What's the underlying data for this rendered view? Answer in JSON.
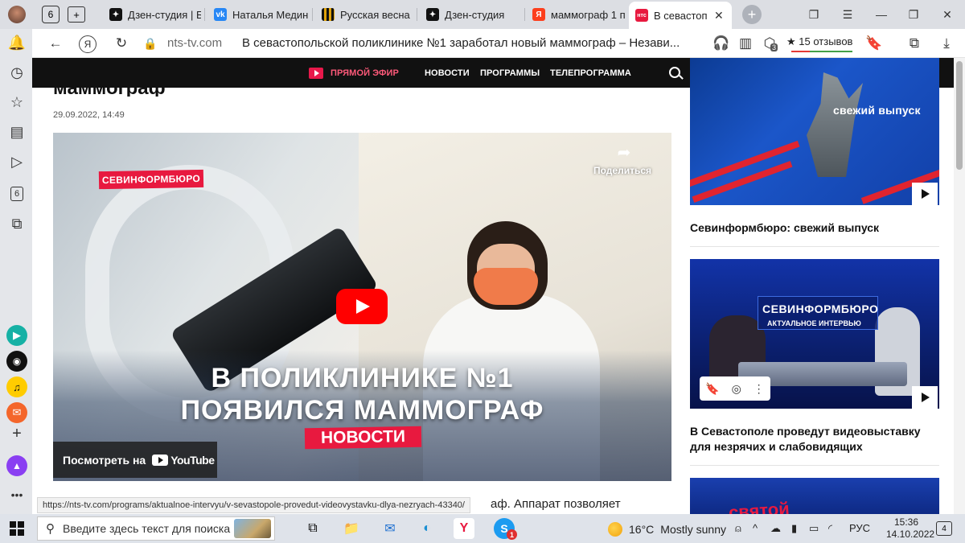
{
  "browser": {
    "tab_counter": "6",
    "tabs": [
      {
        "label": "Дзен-студия | Б",
        "favicon": "dzen-icon",
        "color": "#111111"
      },
      {
        "label": "Наталья Медин",
        "favicon": "vk-icon",
        "color": "#2787f5"
      },
      {
        "label": "Русская весна",
        "favicon": "russian-spring-icon",
        "color": "#e0a20a"
      },
      {
        "label": "Дзен-студия",
        "favicon": "dzen-icon",
        "color": "#111111"
      },
      {
        "label": "маммограф 1 п",
        "favicon": "yandex-icon",
        "color": "#fc3f1d"
      },
      {
        "label": "В севастопол",
        "favicon": "nts-icon",
        "color": "#e8193f",
        "favicon_text": "нтс"
      }
    ],
    "address": {
      "yandex_letter": "Я",
      "domain": "nts-tv.com",
      "title": "В севастопольской поликлинике №1 заработал новый маммограф – Незави...",
      "reviews": "15 отзывов",
      "ext_badge": "3"
    }
  },
  "sidebar": {
    "counter": "6",
    "icons": [
      "bell-icon",
      "history-icon",
      "star-icon",
      "collections-icon",
      "play-icon",
      "tab-counter-icon",
      "screenshot-icon",
      "alice-play-icon",
      "camera-icon",
      "music-icon",
      "mail-icon",
      "add-icon",
      "more-icon",
      "alice-icon"
    ]
  },
  "site_nav": {
    "live": "ПРЯМОЙ ЭФИР",
    "news": "НОВОСТИ",
    "programs": "ПРОГРАММЫ",
    "tv": "ТЕЛЕПРОГРАММА"
  },
  "article": {
    "title": "маммограф",
    "date": "29.09.2022, 14:49",
    "body": "аф. Аппарат позволяет"
  },
  "video": {
    "badge": "СЕВИНФОРМБЮРО",
    "share": "Поделиться",
    "headline_1": "В ПОЛИКЛИНИКЕ №1",
    "headline_2": "ПОЯВИЛСЯ МАММОГРАФ",
    "news_tag": "НОВОСТИ",
    "watch_on": "Посмотреть на",
    "youtube": "YouTube"
  },
  "sidebar_cards": [
    {
      "thumb_label": "свежий выпуск",
      "title": "Севинформбюро: свежий выпуск"
    },
    {
      "thumb_label_1": "СЕВИНФОРМБЮРО",
      "thumb_label_2": "АКТУАЛЬНОЕ ИНТЕРВЬЮ",
      "title": "В Севастополе проведут видеовыставку для незрячих и слабовидящих"
    },
    {
      "thumb_label": "святой"
    }
  ],
  "status_link": "https://nts-tv.com/programs/aktualnoe-intervyu/v-sevastopole-provedut-videovystavku-dlya-nezryach-43340/",
  "taskbar": {
    "search_placeholder": "Введите здесь текст для поиска",
    "weather_temp": "16°C",
    "weather_text": "Mostly sunny",
    "lang": "РУС",
    "time": "15:36",
    "date": "14.10.2022",
    "notifications": "4",
    "skype_badge": "1"
  },
  "colors": {
    "accent": "#e8193f",
    "nav_bg": "#111111",
    "youtube_red": "#ff0000"
  }
}
